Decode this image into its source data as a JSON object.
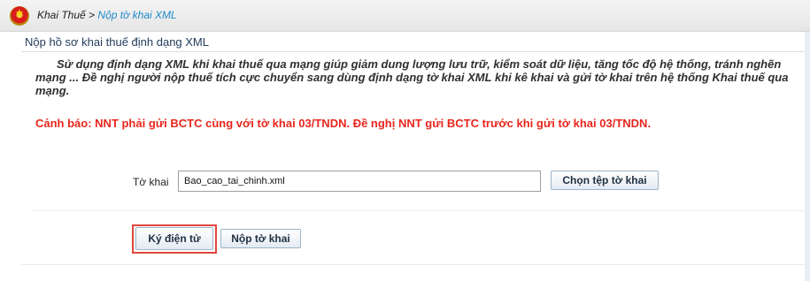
{
  "breadcrumb": {
    "home": "Khai Thuế",
    "separator": ">",
    "current": "Nộp tờ khai XML"
  },
  "section": {
    "title": "Nộp hồ sơ khai thuế định dạng XML",
    "intro": "Sử dụng định dạng XML khi khai thuế qua mạng giúp giảm dung lượng lưu trữ, kiểm soát dữ liệu, tăng tốc độ hệ thống, tránh nghẽn mạng ... Đề nghị người nộp thuế tích cực chuyển sang dùng định dạng tờ khai XML khi kê khai và gửi tờ khai trên hệ thống Khai thuế qua mạng.",
    "warning": "Cảnh báo: NNT phải gửi BCTC cùng với tờ khai 03/TNDN. Đề nghị NNT gửi BCTC trước khi gửi tờ khai 03/TNDN."
  },
  "form": {
    "file_label": "Tờ khai",
    "file_value": "Bao_cao_tai_chinh.xml",
    "choose_button": "Chọn tệp tờ khai",
    "sign_button": "Ký điện tử",
    "submit_button": "Nộp tờ khai"
  },
  "colors": {
    "accent": "#1e8acb",
    "warning": "#e8261d",
    "highlight": "#e0463c"
  },
  "icons": {
    "logo": "national-emblem-icon"
  }
}
